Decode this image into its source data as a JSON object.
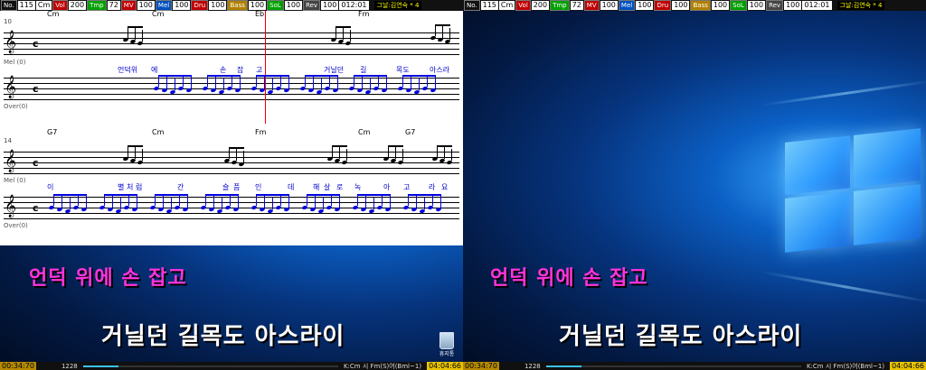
{
  "toolbar": {
    "items": [
      {
        "label": "No.",
        "value": "115"
      },
      {
        "label": "",
        "value": "Cm"
      },
      {
        "label": "Vol",
        "value": "200",
        "color": "#c00000"
      },
      {
        "label": "Tmp",
        "value": "72",
        "color": "#00a000"
      },
      {
        "label": "MV",
        "value": "100",
        "color": "#c00000"
      },
      {
        "label": "Mel",
        "value": "100",
        "color": "#0050c0"
      },
      {
        "label": "Dru",
        "value": "100",
        "color": "#c00000"
      },
      {
        "label": "Bass",
        "value": "100",
        "color": "#b08000"
      },
      {
        "label": "SoL",
        "value": "100",
        "color": "#00a000"
      },
      {
        "label": "Rev",
        "value": "100",
        "color": "#444444"
      },
      {
        "label": "",
        "value": "012:01"
      }
    ],
    "title": "그날:김연숙 * 4"
  },
  "score": {
    "system1": {
      "measure_number": "10",
      "chords": [
        "Cm",
        "Cm",
        "Eb",
        "Fm"
      ],
      "track_mel": "Mel (0)",
      "track_over": "Over(0)",
      "lyrics": [
        "언덕위",
        "에",
        "손",
        "잡",
        "고",
        "거닐던",
        "길",
        "목도",
        "아스라"
      ]
    },
    "system2": {
      "measure_number": "14",
      "chords": [
        "G7",
        "Cm",
        "Fm",
        "Cm",
        "G7"
      ],
      "track_mel": "Mel (0)",
      "track_over": "Over(0)",
      "lyrics": [
        "이",
        "별",
        "처",
        "럼",
        "간",
        "슬",
        "픔",
        "인",
        "데",
        "해",
        "살",
        "로",
        "녹",
        "아",
        "고",
        "라",
        "요"
      ]
    }
  },
  "lyrics_display": {
    "line1": "언덕 위에 손 잡고",
    "line2": "거닐던 길목도 아스라이"
  },
  "status_bar": {
    "left_time": "00:34:70",
    "counter": "1228",
    "info": "K:Cm 시 Fm(S)어(Bml~1)",
    "right_time": "04:04:66",
    "progress": 0.14
  },
  "desktop": {
    "recycle_bin_label": "휴지통"
  },
  "colors": {
    "lyric_line1": "#ff33dd",
    "lyric_line2": "#ffffff",
    "score_blue": "#0000e0",
    "cursor": "#ee0000"
  }
}
